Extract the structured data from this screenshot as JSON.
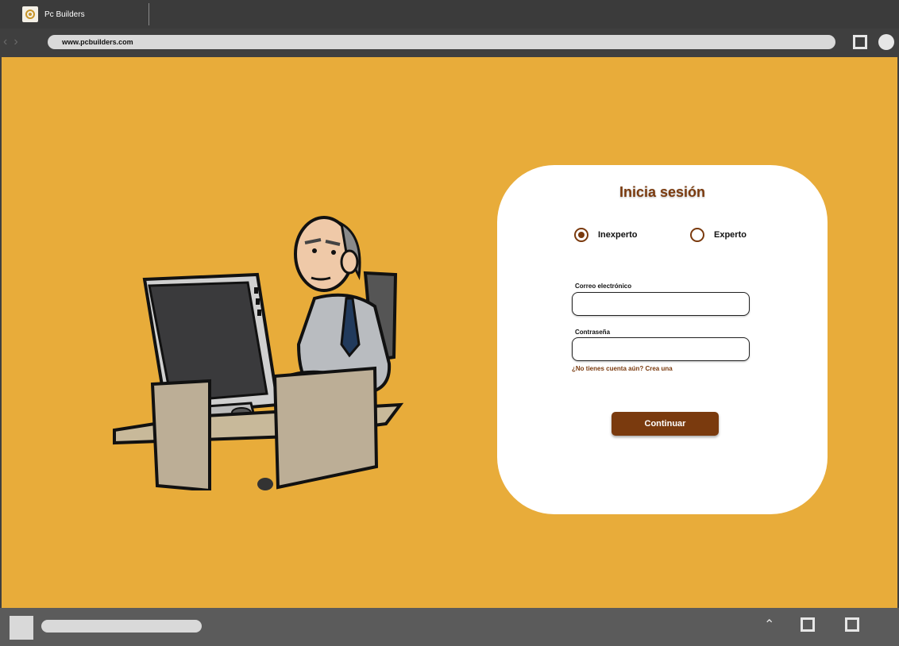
{
  "browser": {
    "tab_title": "Pc Builders",
    "url": "www.pcbuilders.com"
  },
  "login": {
    "title": "Inicia sesión",
    "levels": [
      "Inexperto",
      "Experto"
    ],
    "selected_level": "Inexperto",
    "email_label": "Correo electrónico",
    "email_value": "",
    "password_label": "Contraseña",
    "password_value": "",
    "register_link": "¿No tienes cuenta aún? Crea una",
    "submit_label": "Continuar"
  },
  "colors": {
    "page_background": "#e8ac3a",
    "accent": "#7a3a0e",
    "card": "#ffffff"
  },
  "icons": [
    "back-arrow-icon",
    "forward-arrow-icon",
    "maximize-icon",
    "profile-icon",
    "chevron-up-icon"
  ]
}
